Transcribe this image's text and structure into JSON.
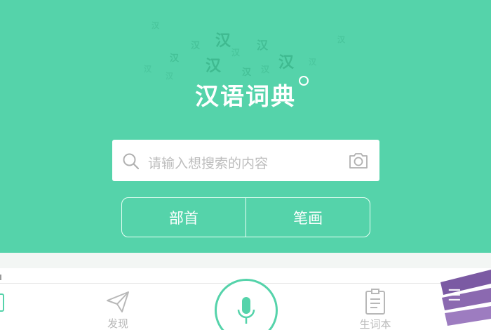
{
  "app": {
    "logo_text": "汉语词典",
    "deco_char": "汉"
  },
  "search": {
    "placeholder": "请输入想搜索的内容"
  },
  "modes": {
    "radical": "部首",
    "strokes": "笔画"
  },
  "tabs": {
    "discover": "发现",
    "wordbook": "生词本"
  },
  "colors": {
    "accent": "#55d3aa",
    "white": "#ffffff",
    "muted": "#b8b8b8",
    "placeholder": "#bdbdbd"
  },
  "icons": {
    "search": "search-icon",
    "camera": "camera-icon",
    "mic": "microphone-icon",
    "discover": "paper-plane-icon",
    "wordbook": "notebook-icon"
  }
}
